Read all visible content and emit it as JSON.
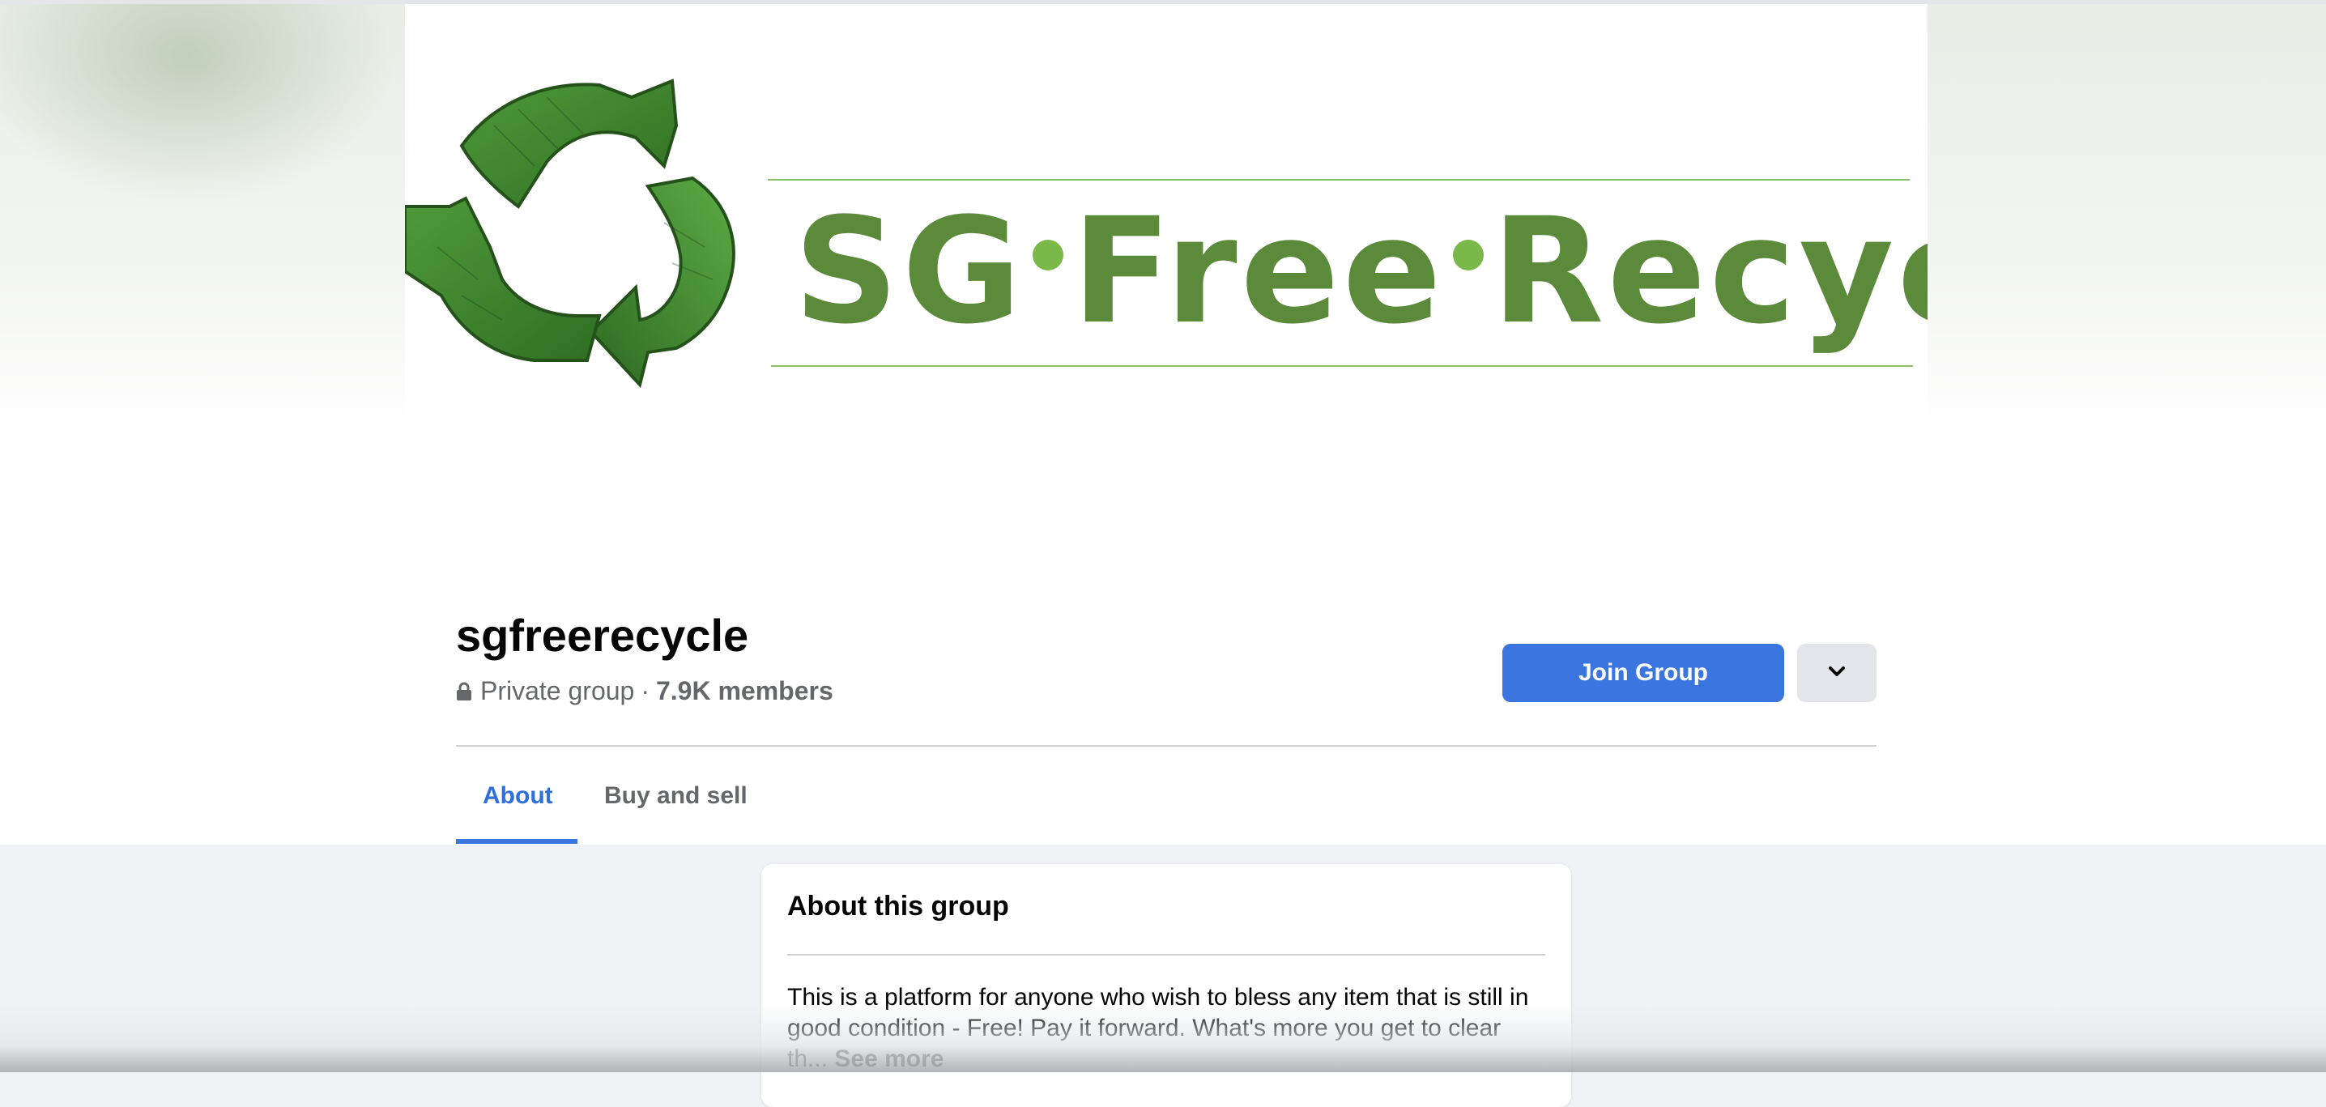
{
  "cover": {
    "alt": "SG Free Recycle cover",
    "words": [
      "SG",
      "Free",
      "Recycle"
    ],
    "brand_color": "#5b8a3a",
    "logo_icon": "recycle-icon"
  },
  "group": {
    "name": "sgfreerecycle",
    "privacy_icon": "lock-icon",
    "privacy": "Private group",
    "separator": "·",
    "members": "7.9K members"
  },
  "actions": {
    "join_label": "Join Group",
    "more_icon": "chevron-down-icon",
    "accent": "#3a75e0"
  },
  "tabs": [
    {
      "label": "About",
      "active": true
    },
    {
      "label": "Buy and sell",
      "active": false
    }
  ],
  "about": {
    "title": "About this group",
    "description": "This is a platform for anyone who wish to bless any item that is still in good condition - Free! Pay it forward. What's more you get to clear th...",
    "see_more": "See more"
  }
}
